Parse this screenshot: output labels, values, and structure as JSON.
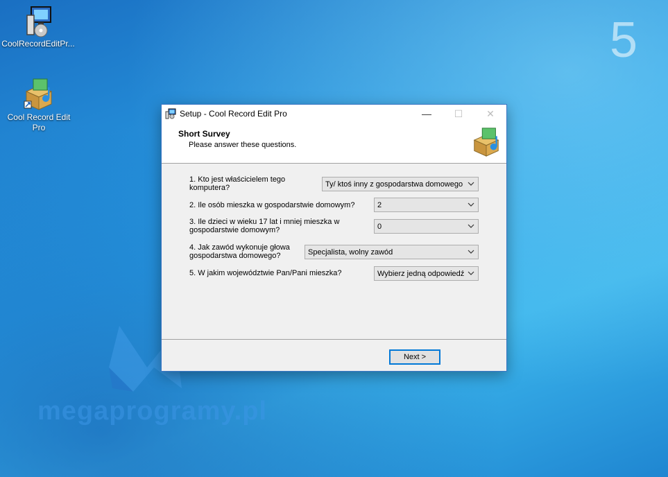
{
  "desktop": {
    "step_number": "5",
    "icons": [
      {
        "label": "CoolRecordEditPr..."
      },
      {
        "label": "Cool Record Edit Pro"
      }
    ],
    "watermark": "megaprogramy.pl"
  },
  "window": {
    "title": "Setup - Cool Record Edit Pro",
    "controls": {
      "minimize": "—",
      "maximize": "☐",
      "close": "✕"
    },
    "header": {
      "title": "Short Survey",
      "subtitle": "Please answer these questions."
    },
    "questions": [
      {
        "label": "1. Kto jest właścicielem tego komputera?",
        "value": "Ty/ ktoś inny  z gospodarstwa domowego"
      },
      {
        "label": "2. Ile osób mieszka w gospodarstwie domowym?",
        "value": "2"
      },
      {
        "label": "3. Ile dzieci w wieku 17 lat i mniej mieszka w gospodarstwie domowym?",
        "value": "0"
      },
      {
        "label": "4. Jak zawód wykonuje głowa gospodarstwa domowego?",
        "value": "Specjalista,  wolny zawód"
      },
      {
        "label": "5. W jakim województwie Pan/Pani mieszka?",
        "value": "Wybierz jedną odpowiedź"
      }
    ],
    "next_label": "Next >"
  },
  "colors": {
    "accent": "#0078d7",
    "desktop_blue": "#2aa0e6"
  }
}
